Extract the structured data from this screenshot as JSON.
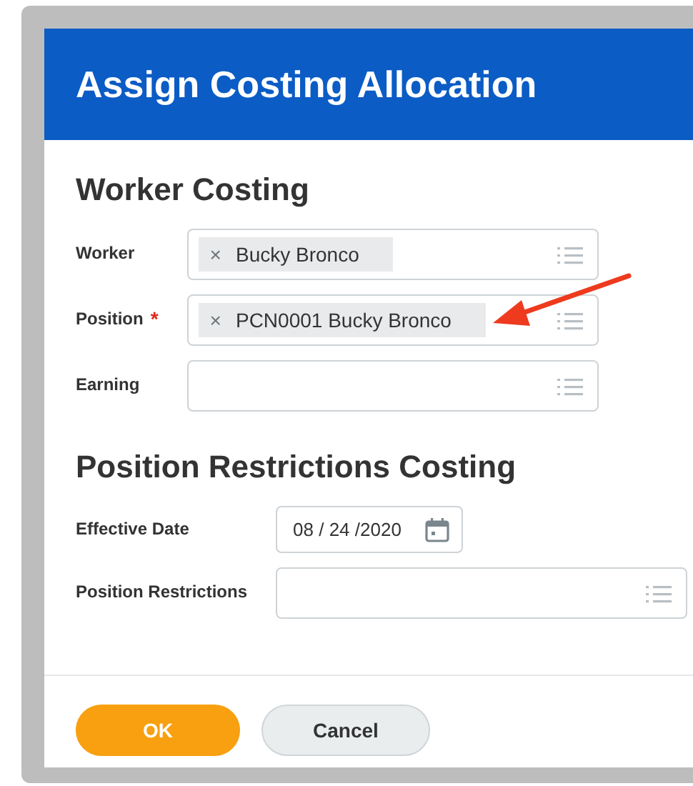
{
  "dialog": {
    "title": "Assign Costing Allocation"
  },
  "sections": [
    {
      "heading": "Worker Costing",
      "fields": [
        {
          "kind": "multiselect",
          "label": "Worker",
          "tokens": [
            {
              "remove": "×",
              "label": "Bucky Bronco"
            }
          ]
        },
        {
          "kind": "multiselect",
          "label": "Position",
          "required_mark": "*",
          "tokens": [
            {
              "remove": "×",
              "label": "PCN0001 Bucky Bronco"
            }
          ]
        },
        {
          "kind": "multiselect",
          "label": "Earning"
        }
      ]
    },
    {
      "heading": "Position Restrictions Costing",
      "fields": [
        {
          "kind": "date",
          "label": "Effective Date",
          "value": "08 / 24 /2020"
        },
        {
          "kind": "multiselect",
          "label": "Position Restrictions"
        }
      ]
    }
  ],
  "buttons": [
    {
      "label": "OK",
      "kind": "primary"
    },
    {
      "label": "Cancel",
      "kind": "secondary"
    }
  ],
  "annotation": {
    "kind": "arrow"
  }
}
